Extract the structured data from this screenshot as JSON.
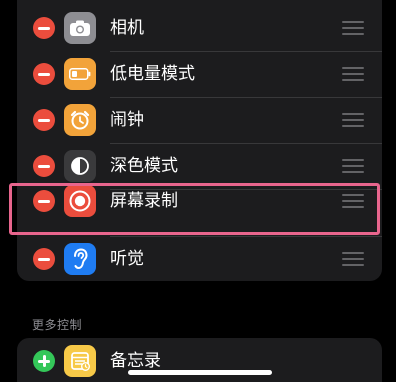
{
  "included_controls": [
    {
      "label": "相机",
      "icon": "camera-icon",
      "icon_color": "#8e8e93"
    },
    {
      "label": "低电量模式",
      "icon": "battery-icon",
      "icon_color": "#f2a33a"
    },
    {
      "label": "闹钟",
      "icon": "alarm-clock-icon",
      "icon_color": "#f2a33a"
    },
    {
      "label": "深色模式",
      "icon": "dark-mode-icon",
      "icon_color": "#3a3a3c"
    },
    {
      "label": "屏幕录制",
      "icon": "screen-record-icon",
      "icon_color": "#eb4d3d"
    },
    {
      "label": "听觉",
      "icon": "ear-icon",
      "icon_color": "#1f7cf2"
    }
  ],
  "more_controls": {
    "header": "更多控制",
    "items": [
      {
        "label": "备忘录",
        "icon": "notes-icon",
        "icon_color": "#f7c948"
      }
    ]
  },
  "colors": {
    "remove": "#eb4d3d",
    "add": "#34c759",
    "highlight": "#e8658d"
  }
}
